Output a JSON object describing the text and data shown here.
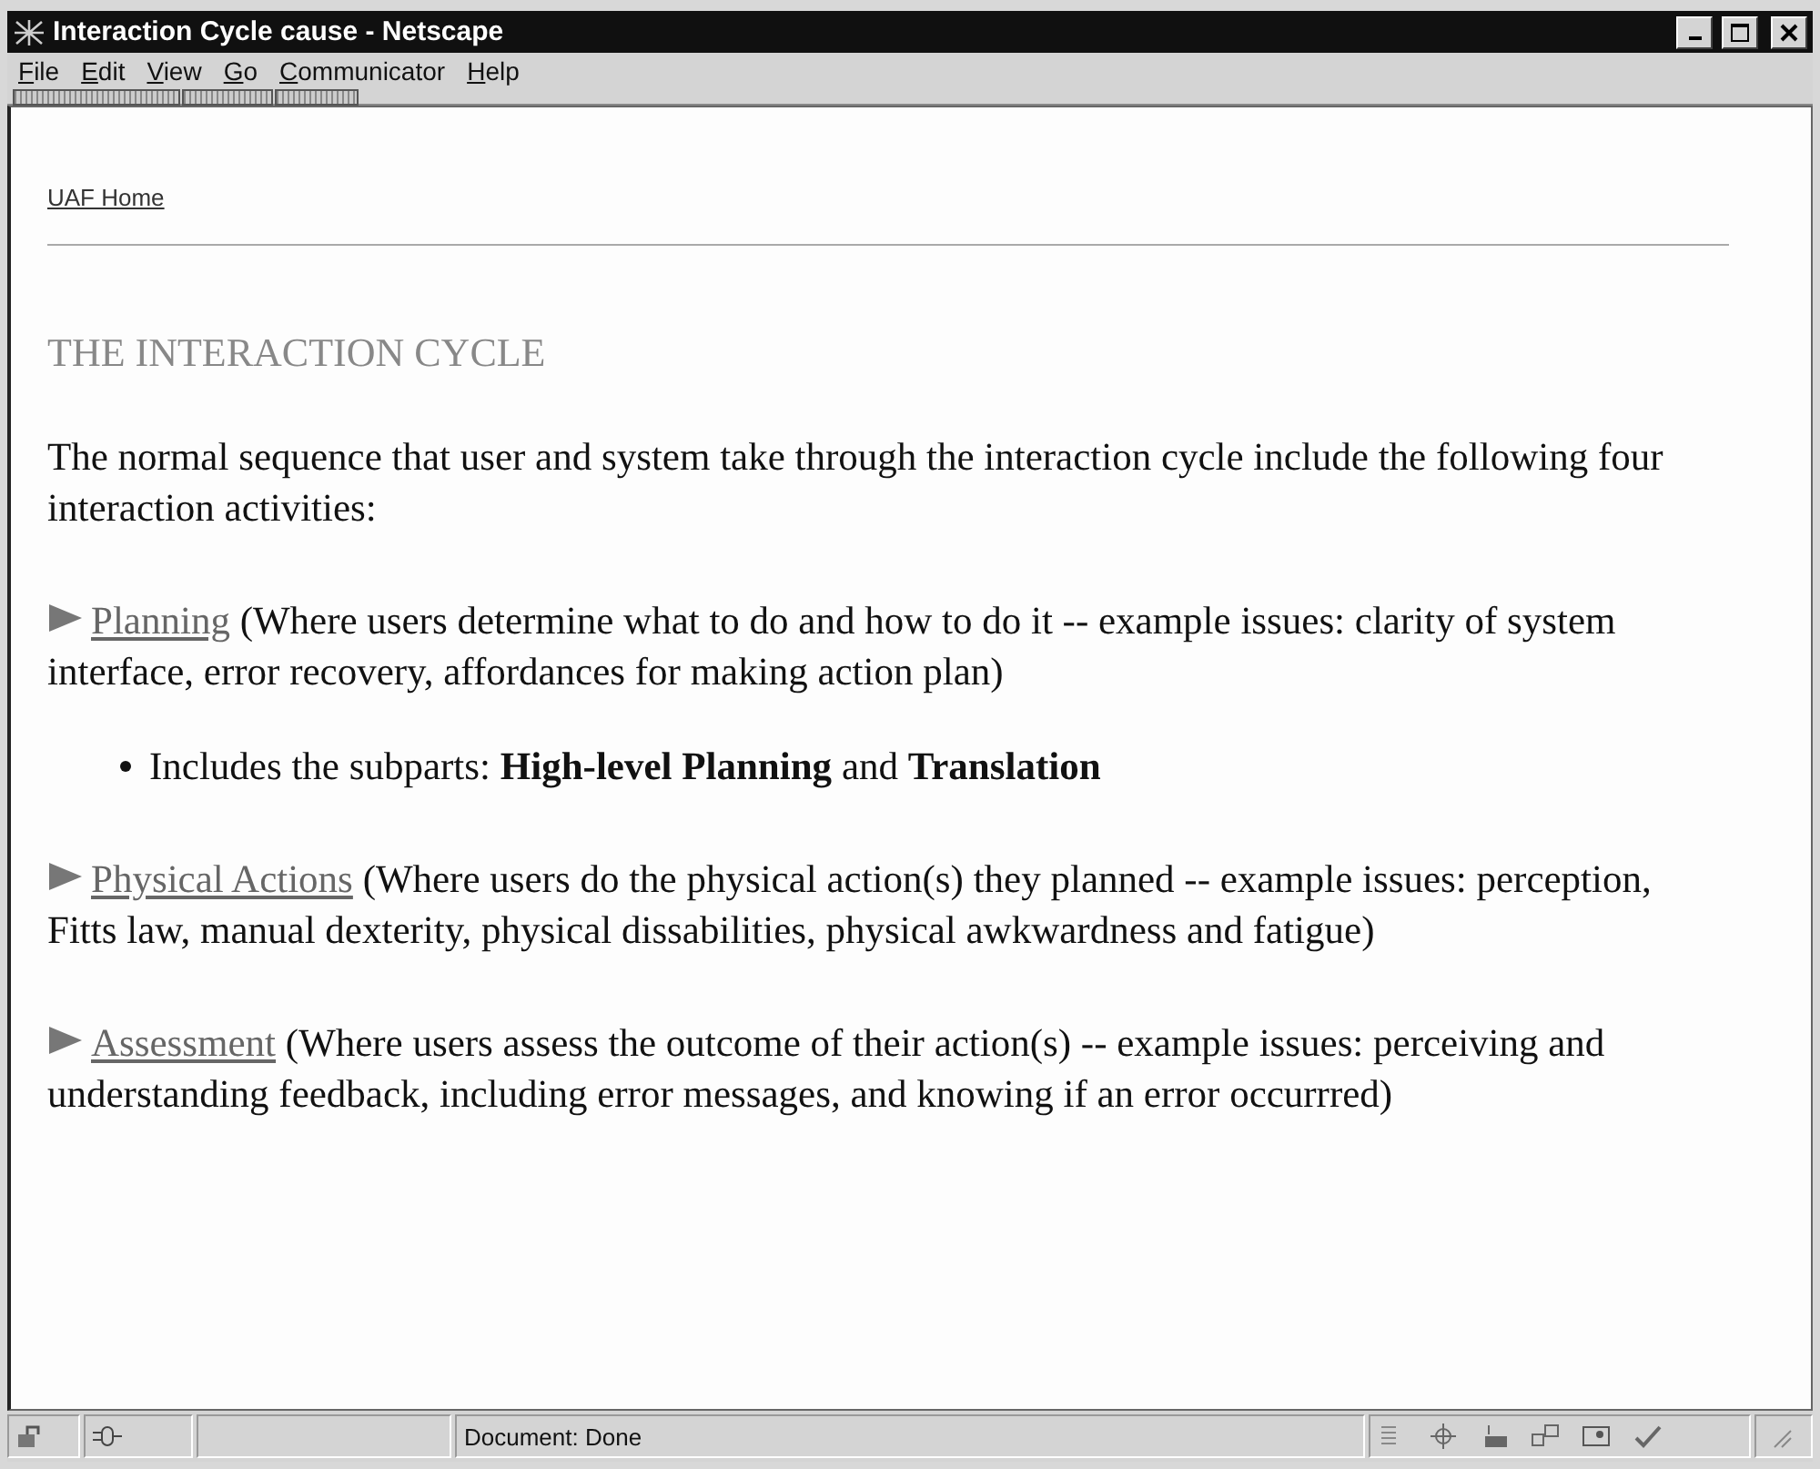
{
  "window": {
    "title": "Interaction Cycle cause - Netscape"
  },
  "menu": [
    "File",
    "Edit",
    "View",
    "Go",
    "Communicator",
    "Help"
  ],
  "page": {
    "home_link": "UAF Home",
    "heading": "THE INTERACTION CYCLE",
    "intro": "The normal sequence that user and system take through the interaction cycle include the following four interaction activities:",
    "activities": [
      {
        "link": "Planning",
        "text": " (Where users determine what to do and how to do it -- example issues: clarity of system interface, error recovery, affordances for making action plan)",
        "subitems": [
          "Includes the subparts: **High-level Planning** and **Translation**"
        ]
      },
      {
        "link": "Physical Actions",
        "text": " (Where users do the physical action(s) they planned -- example issues: perception, Fitts law, manual dexterity, physical dissabilities, physical awkwardness and fatigue)"
      },
      {
        "link": "Assessment",
        "text": " (Where users assess the outcome of their action(s) -- example issues: perceiving and understanding feedback, including error messages, and knowing if an error occurrred)"
      }
    ]
  },
  "status_bar": {
    "text": "Document: Done"
  }
}
